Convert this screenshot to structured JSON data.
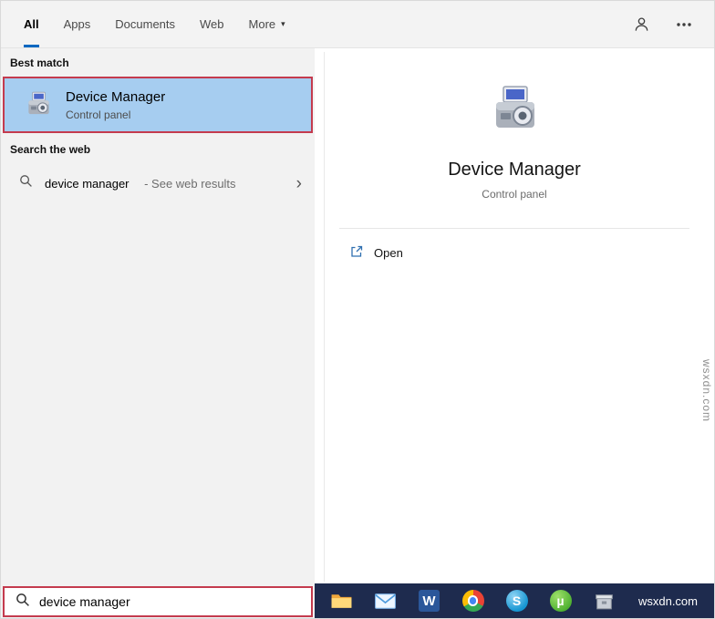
{
  "colors": {
    "accent_blue": "#0067c0",
    "best_match_highlight": "#a6cdf0",
    "annotation_red": "#c43b4e",
    "taskbar_navy": "#1e2b4e"
  },
  "tabs": {
    "items": [
      "All",
      "Apps",
      "Documents",
      "Web",
      "More"
    ],
    "selected": "All"
  },
  "left_panel": {
    "best_match_label": "Best match",
    "best_match": {
      "title": "Device Manager",
      "subtitle": "Control panel"
    },
    "search_web_label": "Search the web",
    "web_result": {
      "query": "device manager",
      "suffix": " - See web results"
    }
  },
  "preview": {
    "title": "Device Manager",
    "subtitle": "Control panel",
    "open_label": "Open"
  },
  "search_box": {
    "value": "device manager"
  },
  "taskbar": {
    "icons": [
      "file-explorer",
      "mail",
      "word",
      "chrome",
      "skype",
      "utorrent",
      "installer"
    ],
    "watermark": "wsxdn.com"
  },
  "watermark_side": "wsxdn.com",
  "glyphs": {
    "more_caret": "▾",
    "chevron_right": "›",
    "word_letter": "W",
    "skype_letter": "S",
    "utorrent_letter": "µ"
  }
}
